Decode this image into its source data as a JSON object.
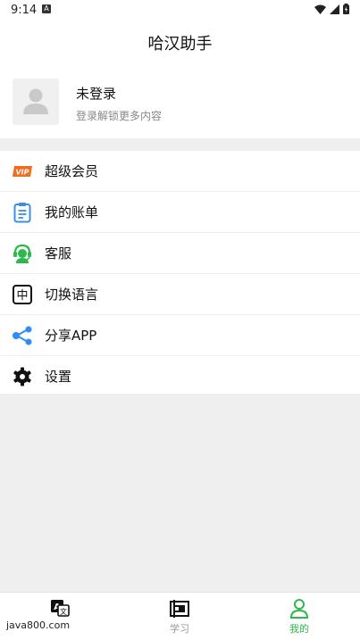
{
  "status_bar": {
    "time": "9:14",
    "notif_glyph": "A"
  },
  "header": {
    "title": "哈汉助手"
  },
  "profile": {
    "name": "未登录",
    "subtitle": "登录解锁更多内容"
  },
  "menu": [
    {
      "label": "超级会员",
      "icon": "vip-icon"
    },
    {
      "label": "我的账单",
      "icon": "bill-icon"
    },
    {
      "label": "客服",
      "icon": "customer-service-icon"
    },
    {
      "label": "切换语言",
      "icon": "language-icon",
      "icon_glyph": "中"
    },
    {
      "label": "分享APP",
      "icon": "share-icon"
    },
    {
      "label": "设置",
      "icon": "gear-icon"
    }
  ],
  "vip_badge": "VIP",
  "bottom_nav": [
    {
      "label": "",
      "icon": "translate-icon"
    },
    {
      "label": "学习",
      "icon": "study-icon"
    },
    {
      "label": "我的",
      "icon": "person-icon",
      "active": true
    }
  ],
  "watermark": "java800.com",
  "colors": {
    "accent": "#2db84b",
    "vip_orange": "#f26b1d",
    "bill_blue": "#3a8ee6",
    "share_blue": "#2e8ef0"
  }
}
